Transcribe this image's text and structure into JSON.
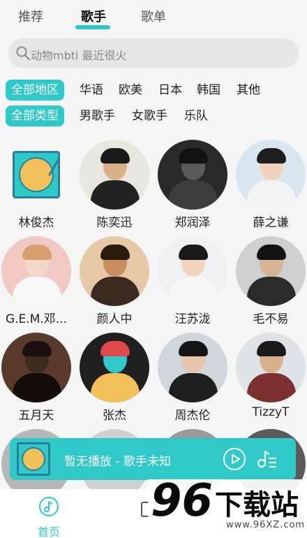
{
  "tabs": [
    "推荐",
    "歌手",
    "歌单"
  ],
  "search": {
    "placeholder": "动物mbti 最近很火"
  },
  "filters": {
    "region": [
      "全部地区",
      "华语",
      "欧美",
      "日本",
      "韩国",
      "其他"
    ],
    "type": [
      "全部类型",
      "男歌手",
      "女歌手",
      "乐队"
    ]
  },
  "singers": [
    {
      "name": "林俊杰",
      "icon": "turntable-icon"
    },
    {
      "name": "陈奕迅",
      "bg": "#e9e6df",
      "face": "#d8b08a",
      "hair": "#1a1a1a",
      "body": "#222222"
    },
    {
      "name": "郑润泽",
      "bg": "#2a2a2a",
      "face": "#5a5a5a",
      "hair": "#111111",
      "body": "#3d3d3d"
    },
    {
      "name": "薛之谦",
      "bg": "#d9e6f0",
      "face": "#f1d2bd",
      "hair": "#1e1e1e",
      "body": "#f4f4f4"
    },
    {
      "name": "G.E.M.邓...",
      "bg": "#f2c9c2",
      "face": "#f5d9c8",
      "hair": "#d8a06e",
      "body": "#f8f8f8"
    },
    {
      "name": "颜人中",
      "bg": "#e6c9a6",
      "face": "#c88e5e",
      "hair": "#2a1a10",
      "body": "#3a2a20"
    },
    {
      "name": "汪苏泷",
      "bg": "#eef0f2",
      "face": "#f0d4bf",
      "hair": "#1a1a1a",
      "body": "#f6f6f6"
    },
    {
      "name": "毛不易",
      "bg": "#cfcfcf",
      "face": "#d6b392",
      "hair": "#111111",
      "body": "#2b2b2b"
    },
    {
      "name": "五月天",
      "bg": "#5a3a2a",
      "face": "#3a2a20",
      "hair": "#1a1010",
      "body": "#140d0a"
    },
    {
      "name": "张杰",
      "bg": "#202020",
      "face": "#2fc9c9",
      "hair": "#e04a4a",
      "body": "#f4c05a"
    },
    {
      "name": "周杰伦",
      "bg": "#cfd6dc",
      "face": "#e8c5a8",
      "hair": "#141414",
      "body": "#1f1f1f"
    },
    {
      "name": "TizzyT",
      "bg": "#dde3e6",
      "face": "#d8b08a",
      "hair": "#1a1a1a",
      "body": "#7b2f2f"
    }
  ],
  "player": {
    "text": "暂无播放 - 歌手未知"
  },
  "bottom_nav": {
    "home_label": "首页"
  },
  "watermark": {
    "number": "96",
    "title": "下载站",
    "url": "www.96XZ.com"
  },
  "colors": {
    "accent": "#2fc9c9",
    "turntable_disc": "#f4c05a",
    "turntable_frame": "#2a7fa0"
  }
}
